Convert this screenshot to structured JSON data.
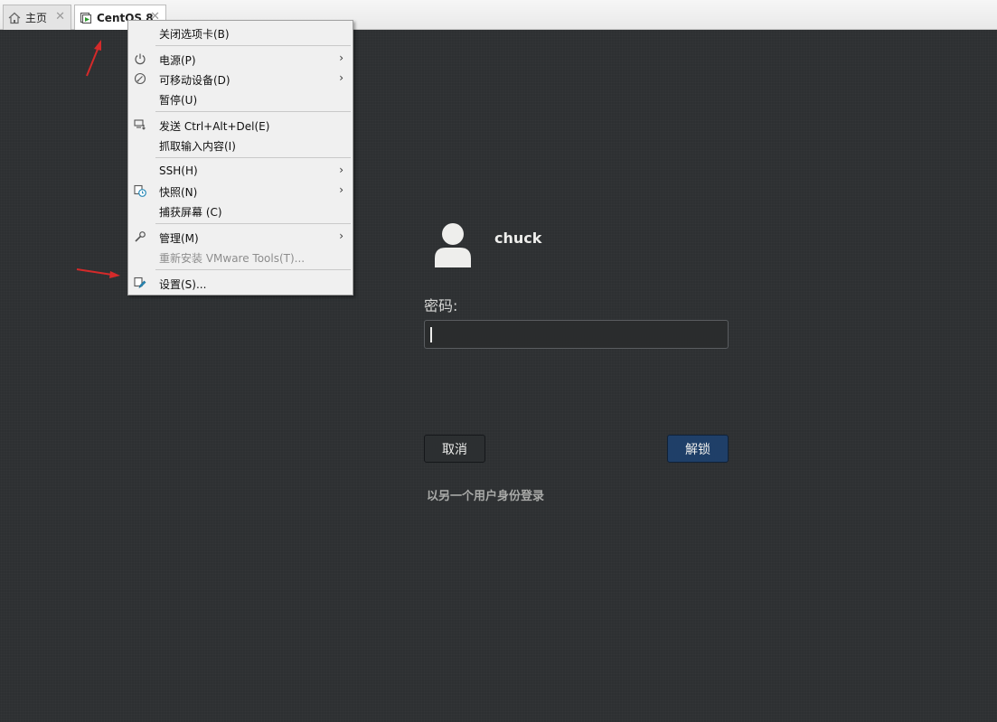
{
  "tabs": [
    {
      "label": "主页",
      "icon": "home-icon",
      "close": "✕"
    },
    {
      "label": "CentOS 8",
      "icon": "vm-running-icon",
      "close": "✕"
    }
  ],
  "context_menu": {
    "items": [
      {
        "label": "关闭选项卡(B)"
      },
      {
        "label": "电源(P)",
        "icon": "power-icon",
        "submenu": "›"
      },
      {
        "label": "可移动设备(D)",
        "icon": "removable-device-icon",
        "submenu": "›"
      },
      {
        "label": "暂停(U)"
      },
      {
        "label": "发送 Ctrl+Alt+Del(E)",
        "icon": "send-keys-icon"
      },
      {
        "label": "抓取输入内容(I)"
      },
      {
        "label": "SSH(H)",
        "submenu": "›"
      },
      {
        "label": "快照(N)",
        "icon": "snapshot-icon",
        "submenu": "›"
      },
      {
        "label": "捕获屏幕 (C)"
      },
      {
        "label": "管理(M)",
        "icon": "wrench-icon",
        "submenu": "›"
      },
      {
        "label": "重新安装 VMware Tools(T)...",
        "disabled": true
      },
      {
        "label": "设置(S)...",
        "icon": "settings-icon"
      }
    ]
  },
  "login": {
    "username": "chuck",
    "password_label": "密码:",
    "password_value": "",
    "cancel_label": "取消",
    "unlock_label": "解锁",
    "other_user_label": "以另一个用户身份登录"
  },
  "colors": {
    "desktop_bg": "#2d3032",
    "unlock_button": "#1f3f68",
    "annotation_arrow": "#d42a2a"
  }
}
